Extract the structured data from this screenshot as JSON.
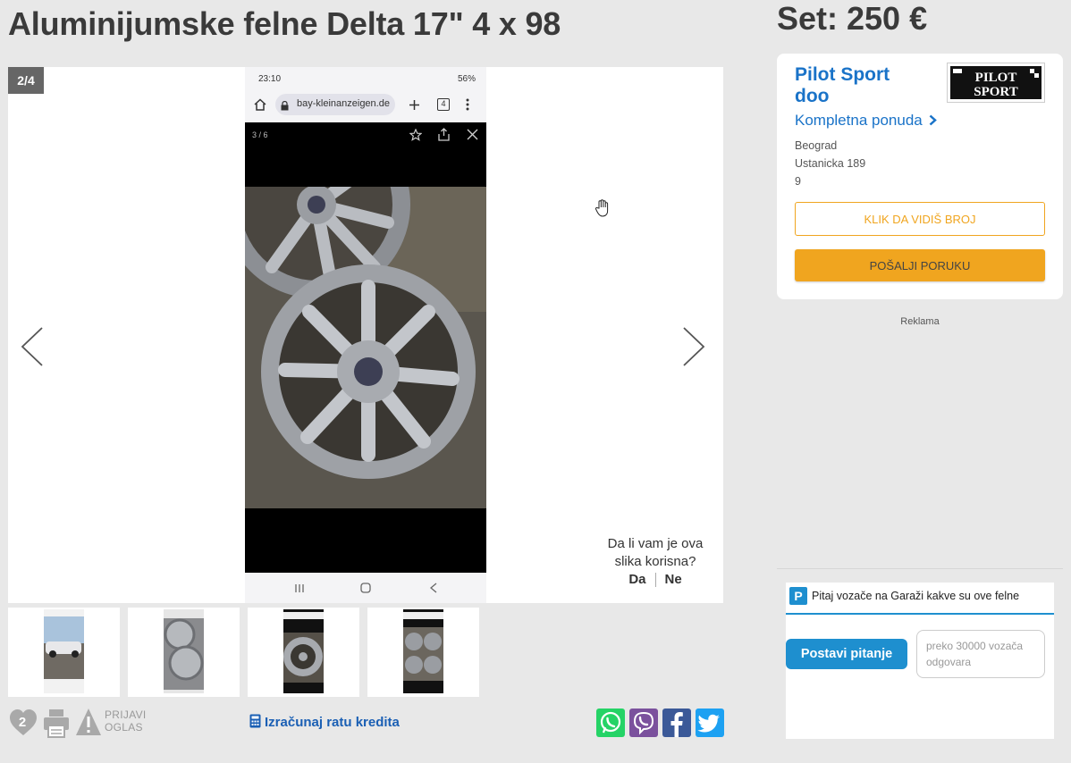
{
  "listing": {
    "title": "Aluminijumske felne Delta 17\" 4 x 98",
    "price": "Set: 250 €"
  },
  "gallery": {
    "counter": "2/4",
    "helpful_question": "Da li vam je ova slika korisna?",
    "helpful_yes": "Da",
    "helpful_no": "Ne",
    "screenshot": {
      "time": "23:10",
      "battery": "56%",
      "url": "bay-kleinanzeigen.de",
      "tab_count": "4",
      "photo_counter": "3 / 6"
    }
  },
  "actions": {
    "favorites_count": "2",
    "report_line1": "PRIJAVI",
    "report_line2": "OGLAS",
    "credit_label": "Izračunaj ratu kredita"
  },
  "dealer": {
    "name": "Pilot Sport doo",
    "logo_text_top": "PILOT",
    "logo_text_bottom": "SPORT",
    "offer_label": "Kompletna ponuda",
    "city": "Beograd",
    "street": "Ustanicka 189",
    "number": "9",
    "phone_button": "KLIK DA VIDIŠ BROJ",
    "message_button": "POŠALJI PORUKU"
  },
  "ad": {
    "label": "Reklama"
  },
  "garaza": {
    "text": "Pitaj vozače na Garaži kakve su ove felne",
    "button": "Postavi pitanje",
    "bubble": "preko 30000 vozača odgovara"
  },
  "colors": {
    "accent": "#f0a51f",
    "link": "#1a73c8",
    "garaza": "#1e8fcf",
    "whatsapp": "#25d366",
    "viber": "#7b519d",
    "facebook": "#3b5998",
    "twitter": "#1da1f2"
  }
}
